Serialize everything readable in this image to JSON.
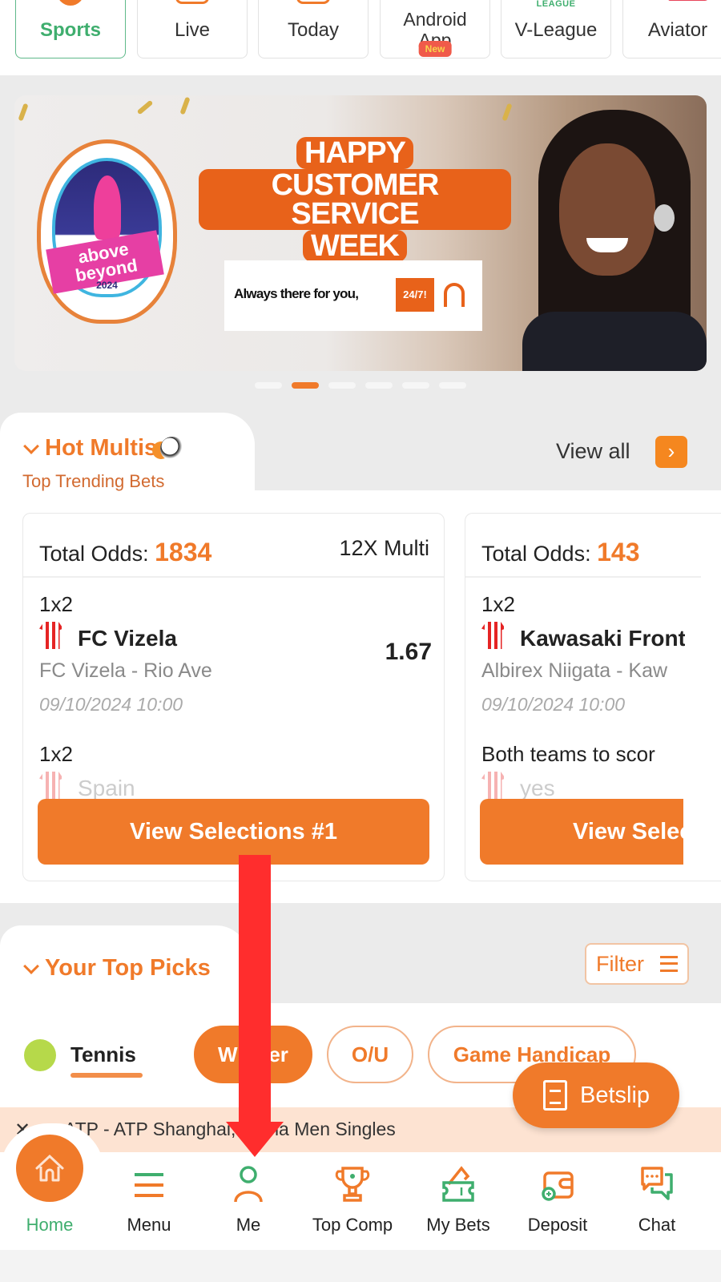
{
  "categories": [
    {
      "label": "Sports",
      "icon": "soccer-ball-icon",
      "active": true
    },
    {
      "label": "Live",
      "icon": "live-tv-icon"
    },
    {
      "label": "Today",
      "icon": "calendar-icon"
    },
    {
      "label": "Android App",
      "icon": "android-icon",
      "badge": "New"
    },
    {
      "label": "V-League",
      "icon": "league-logo-icon",
      "icon_text": "LEAGUE"
    },
    {
      "label": "Aviator",
      "icon": "plane-icon"
    }
  ],
  "banner": {
    "badge_line1": "above",
    "badge_line2": "beyond",
    "badge_year": "2024",
    "headline_1": "HAPPY",
    "headline_2": "CUSTOMER SERVICE",
    "headline_3": "WEEK",
    "tagline": "Always there for you,",
    "tag_247": "24/7!",
    "slides_total": 6,
    "active_slide": 2
  },
  "hot_multis": {
    "title": "Hot Multis",
    "subtitle": "Top Trending Bets",
    "view_all": "View all",
    "cards": [
      {
        "total_label": "Total Odds:",
        "total_value": "1834",
        "multi": "12X Multi",
        "selections": [
          {
            "market": "1x2",
            "pick": "FC Vizela",
            "match": "FC Vizela - Rio Ave",
            "date": "09/10/2024 10:00",
            "odd": "1.67"
          },
          {
            "market": "1x2",
            "pick": "Spain",
            "faded": true
          }
        ],
        "button": "View Selections #1"
      },
      {
        "total_label": "Total Odds:",
        "total_value": "143",
        "selections": [
          {
            "market": "1x2",
            "pick": "Kawasaki Front",
            "match": "Albirex Niigata - Kaw",
            "date": "09/10/2024 10:00"
          },
          {
            "market": "Both teams to scor",
            "pick": "yes",
            "faded": true
          }
        ],
        "button": "View Selec"
      }
    ]
  },
  "top_picks": {
    "title": "Your Top Picks",
    "filter": "Filter",
    "sport": "Tennis",
    "markets": [
      {
        "label": "Winner",
        "active": true
      },
      {
        "label": "O/U"
      },
      {
        "label": "Game Handicap"
      }
    ],
    "league": "ATP - ATP Shanghai, China Men Singles"
  },
  "betslip": {
    "label": "Betslip"
  },
  "bottom_nav": [
    {
      "label": "Home",
      "icon": "home-icon",
      "active": true
    },
    {
      "label": "Menu",
      "icon": "menu-icon"
    },
    {
      "label": "Me",
      "icon": "user-icon"
    },
    {
      "label": "Top Comp",
      "icon": "trophy-icon"
    },
    {
      "label": "My Bets",
      "icon": "ticket-icon"
    },
    {
      "label": "Deposit",
      "icon": "wallet-icon"
    },
    {
      "label": "Chat",
      "icon": "chat-icon"
    }
  ],
  "colors": {
    "accent": "#f07a2a",
    "active_green": "#3fae6e",
    "annotation_red": "#ff2d2d",
    "league_bar": "#fde3d2"
  }
}
